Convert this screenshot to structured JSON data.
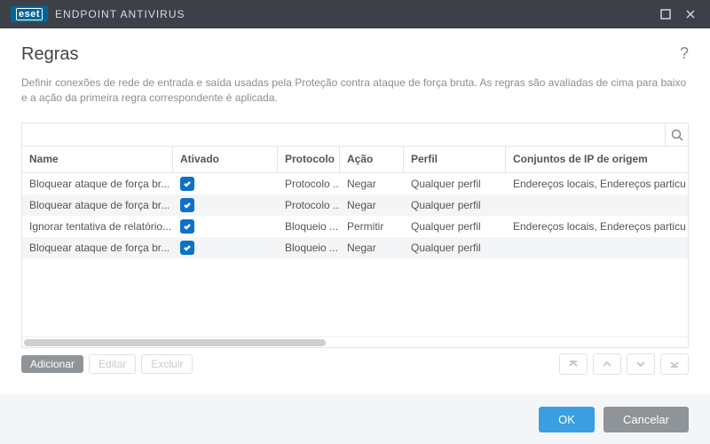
{
  "titlebar": {
    "brand": "eset",
    "product": "ENDPOINT ANTIVIRUS"
  },
  "page": {
    "title": "Regras",
    "description": "Definir conexões de rede de entrada e saída usadas pela Proteção contra ataque de força bruta. As regras são avaliadas de cima para baixo e a ação da primeira regra correspondente é aplicada."
  },
  "columns": {
    "name": "Name",
    "enabled": "Ativado",
    "protocol": "Protocolo",
    "action": "Ação",
    "profile": "Perfil",
    "source_ip": "Conjuntos de IP de origem"
  },
  "rows": [
    {
      "name": "Bloquear ataque de força br...",
      "enabled": true,
      "protocol": "Protocolo ...",
      "action": "Negar",
      "profile": "Qualquer perfil",
      "source_ip": "Endereços locais, Endereços particul"
    },
    {
      "name": "Bloquear ataque de força br...",
      "enabled": true,
      "protocol": "Protocolo ...",
      "action": "Negar",
      "profile": "Qualquer perfil",
      "source_ip": ""
    },
    {
      "name": "Ignorar tentativa de relatório...",
      "enabled": true,
      "protocol": "Bloqueio ...",
      "action": "Permitir",
      "profile": "Qualquer perfil",
      "source_ip": "Endereços locais, Endereços particul"
    },
    {
      "name": "Bloquear ataque de força br...",
      "enabled": true,
      "protocol": "Bloqueio ...",
      "action": "Negar",
      "profile": "Qualquer perfil",
      "source_ip": ""
    }
  ],
  "buttons": {
    "add": "Adicionar",
    "edit": "Editar",
    "delete": "Excluir",
    "ok": "OK",
    "cancel": "Cancelar"
  }
}
